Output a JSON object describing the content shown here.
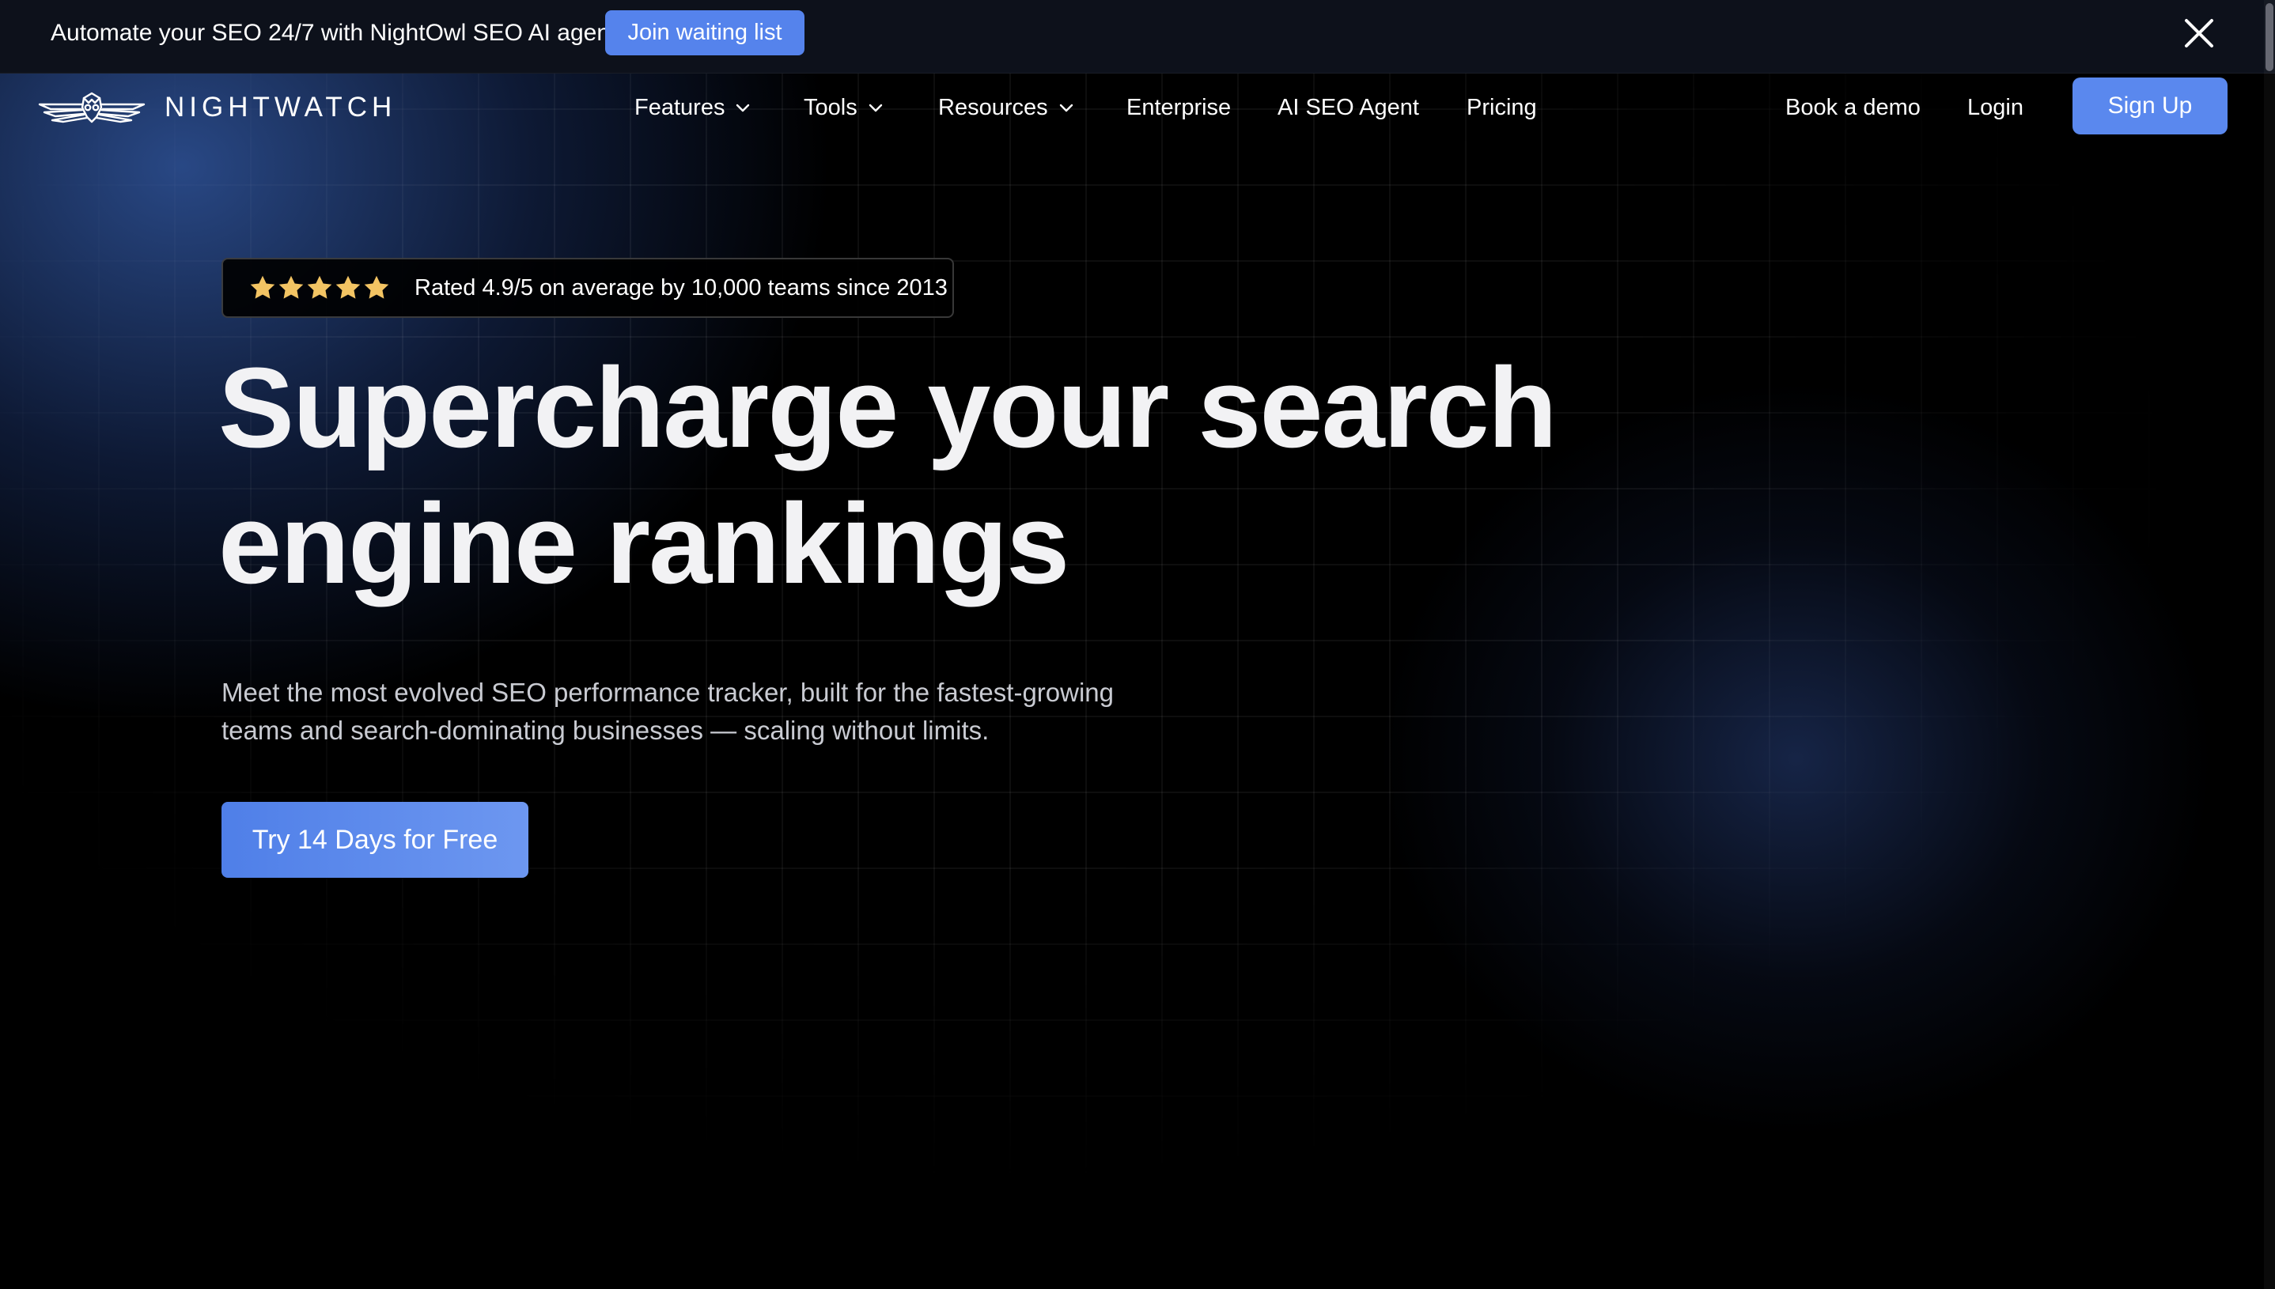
{
  "announcement": {
    "text": "Automate your SEO 24/7 with NightOwl SEO AI agent.",
    "button_label": "Join waiting list",
    "close_icon": "close-icon"
  },
  "nav": {
    "logo_text": "NIGHTWATCH",
    "logo_icon": "owl-logo-icon",
    "items": [
      {
        "label": "Features",
        "has_dropdown": true
      },
      {
        "label": "Tools",
        "has_dropdown": true
      },
      {
        "label": "Resources",
        "has_dropdown": true
      },
      {
        "label": "Enterprise",
        "has_dropdown": false
      },
      {
        "label": "AI SEO Agent",
        "has_dropdown": false
      },
      {
        "label": "Pricing",
        "has_dropdown": false
      }
    ],
    "book_demo_label": "Book a demo",
    "login_label": "Login",
    "signup_label": "Sign Up"
  },
  "hero": {
    "rating": {
      "stars": 5,
      "text": "Rated 4.9/5 on average by 10,000 teams since 2013"
    },
    "title_line1": "Supercharge your search",
    "title_line2": "engine rankings",
    "subtitle_line1": "Meet the most evolved SEO performance tracker, built for the fastest-growing",
    "subtitle_line2": "teams and search-dominating businesses — scaling without limits.",
    "cta_label": "Try 14 Days for Free"
  },
  "colors": {
    "accent": "#5583ec",
    "star": "#f3c463",
    "background": "#000000",
    "announcement_bg": "#0d111b"
  }
}
